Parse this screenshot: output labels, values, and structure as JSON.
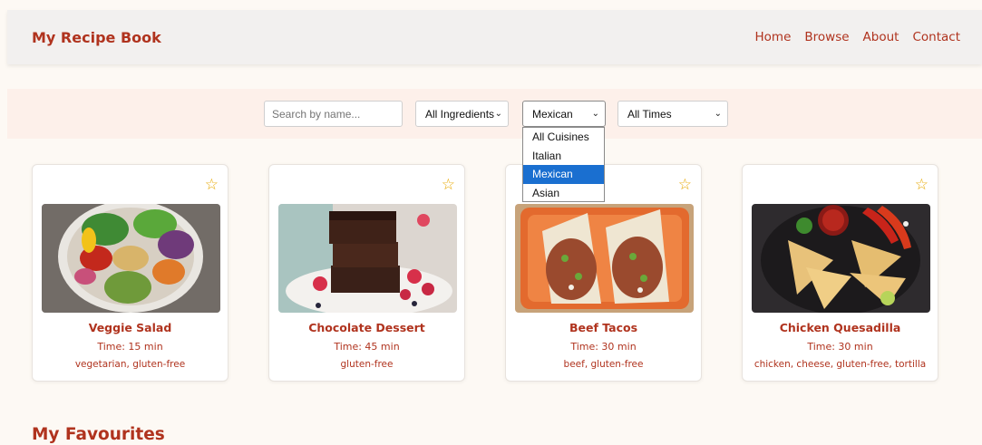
{
  "header": {
    "brand": "My Recipe Book",
    "nav": [
      "Home",
      "Browse",
      "About",
      "Contact"
    ]
  },
  "filters": {
    "search_placeholder": "Search by name...",
    "ingredients": "All Ingredients",
    "cuisine": "Mexican",
    "times": "All Times",
    "cuisine_options": [
      "All Cuisines",
      "Italian",
      "Mexican",
      "Asian"
    ],
    "cuisine_selected_index": 2
  },
  "recipes": [
    {
      "title": "Veggie Salad",
      "time": "Time: 15 min",
      "tags": "vegetarian, gluten-free",
      "image": "salad-bowl"
    },
    {
      "title": "Chocolate Dessert",
      "time": "Time: 45 min",
      "tags": "gluten-free",
      "image": "brownie-stack"
    },
    {
      "title": "Beef Tacos",
      "time": "Time: 30 min",
      "tags": "beef, gluten-free",
      "image": "tacos-tray"
    },
    {
      "title": "Chicken Quesadilla",
      "time": "Time: 30 min",
      "tags": "chicken, cheese, gluten-free, tortilla",
      "image": "quesadilla-plate"
    }
  ],
  "favourites_heading": "My Favourites",
  "icons": {
    "favourite": "star-outline-icon",
    "dropdown": "chevron-down-icon"
  },
  "colors": {
    "accent": "#b0331e",
    "star": "#e8a800",
    "selected_option": "#1a6fd0"
  }
}
